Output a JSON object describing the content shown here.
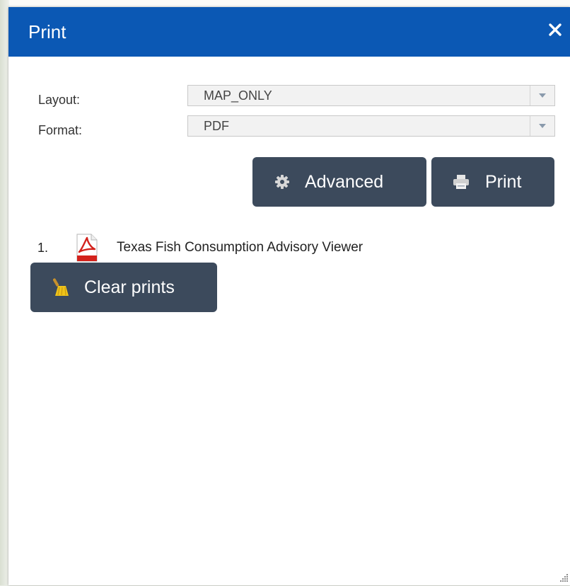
{
  "dialog": {
    "title": "Print",
    "close_icon": "close-icon"
  },
  "settings": {
    "layout_label": "Layout:",
    "layout_value": "MAP_ONLY",
    "format_label": "Format:",
    "format_value": "PDF"
  },
  "actions": {
    "advanced_label": "Advanced",
    "advanced_icon": "gear-icon",
    "print_label": "Print",
    "print_icon": "printer-icon"
  },
  "prints": {
    "items": [
      {
        "number": "1.",
        "icon": "pdf-file-icon",
        "title": "Texas Fish Consumption Advisory Viewer"
      }
    ],
    "clear_label": "Clear prints",
    "clear_icon": "broom-icon"
  },
  "colors": {
    "header_bg": "#0b58b4",
    "button_bg": "#3c4a5c",
    "pdf_red": "#d3221c"
  }
}
